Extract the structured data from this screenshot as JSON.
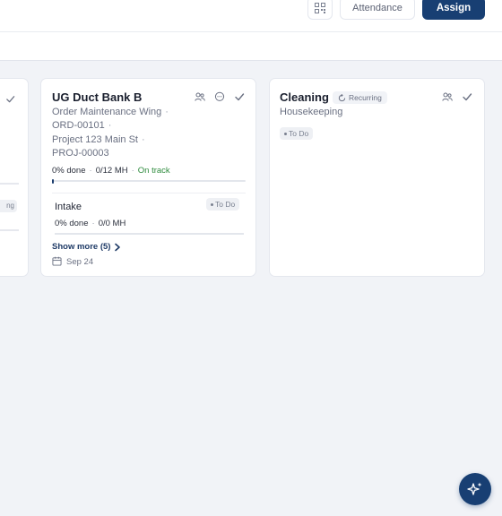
{
  "toolbar": {
    "qr_icon": "qr-code-icon",
    "attendance_label": "Attendance",
    "assign_label": "Assign"
  },
  "colors": {
    "accent": "#183f73",
    "on_track": "#2e8b3d",
    "background": "#f1f3f7"
  },
  "partial_card": {
    "tag_text": "ng"
  },
  "cards": [
    {
      "title": "UG Duct Bank B",
      "meta": [
        "Order Maintenance Wing",
        "ORD-00101",
        "Project 123 Main St",
        "PROJ-00003"
      ],
      "icons": [
        "users-icon",
        "comment-icon",
        "check-icon"
      ],
      "progress_pct": "0% done",
      "progress_mh": "0/12 MH",
      "progress_status": "On track",
      "progress_value": 0,
      "subtask": {
        "name": "Intake",
        "status": "To Do",
        "progress_pct": "0% done",
        "progress_mh": "0/0 MH"
      },
      "show_more": "Show more (5)",
      "date": "Sep 24"
    },
    {
      "title": "Cleaning",
      "recurring_label": "Recurring",
      "meta": [
        "Housekeeping"
      ],
      "icons": [
        "users-icon",
        "check-icon"
      ],
      "status": "To Do"
    }
  ],
  "fab": {
    "icon": "sparkle-ai-icon"
  }
}
